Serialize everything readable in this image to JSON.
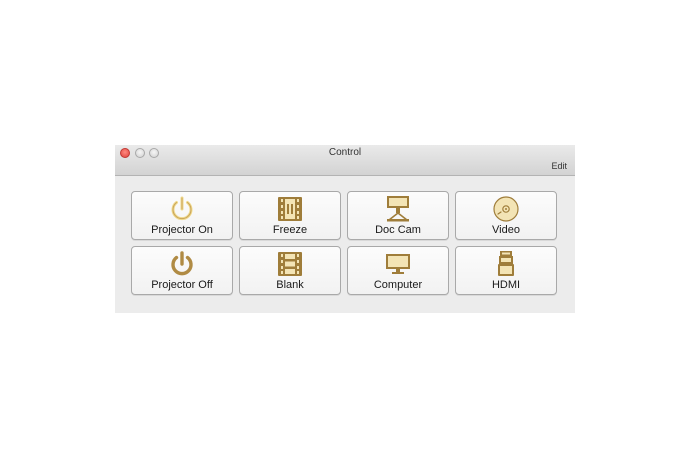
{
  "window": {
    "title": "Control",
    "edit_label": "Edit"
  },
  "buttons": [
    {
      "label": "Projector On",
      "icon": "power-icon"
    },
    {
      "label": "Freeze",
      "icon": "freeze-film-icon"
    },
    {
      "label": "Doc Cam",
      "icon": "document-camera-icon"
    },
    {
      "label": "Video",
      "icon": "disc-icon"
    },
    {
      "label": "Projector Off",
      "icon": "power-icon"
    },
    {
      "label": "Blank",
      "icon": "film-strip-icon"
    },
    {
      "label": "Computer",
      "icon": "monitor-icon"
    },
    {
      "label": "HDMI",
      "icon": "hdmi-connector-icon"
    }
  ],
  "colors": {
    "icon_gold": "#c8a45c",
    "icon_gold_dark": "#9f7d3a",
    "icon_cream": "#f3e4b5"
  }
}
